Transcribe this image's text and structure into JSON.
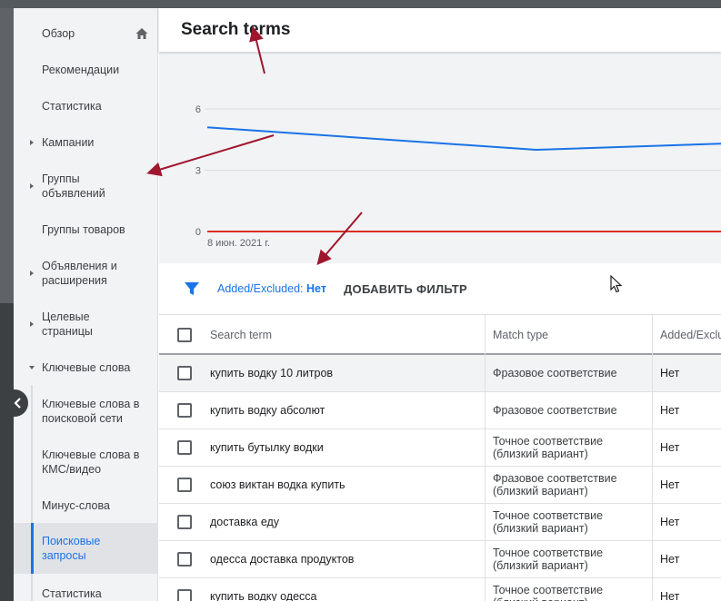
{
  "page_title": "Search terms",
  "sidebar": {
    "items": [
      {
        "label": "Обзор",
        "caret": "none"
      },
      {
        "label": "Рекомендации",
        "caret": "none"
      },
      {
        "label": "Статистика",
        "caret": "none"
      },
      {
        "label": "Кампании",
        "caret": "right"
      },
      {
        "label": "Группы объявлений",
        "caret": "right"
      },
      {
        "label": "Группы товаров",
        "caret": "none"
      },
      {
        "label": "Объявления и расширения",
        "caret": "right"
      },
      {
        "label": "Целевые страницы",
        "caret": "right"
      },
      {
        "label": "Ключевые слова",
        "caret": "down"
      }
    ],
    "subitems": [
      {
        "label": "Ключевые слова в поисковой сети"
      },
      {
        "label": "Ключевые слова в КМС/видео"
      },
      {
        "label": "Минус-слова"
      },
      {
        "label": "Поисковые запросы",
        "selected": true
      },
      {
        "label": "Статистика"
      }
    ]
  },
  "chart_data": {
    "type": "line",
    "x_start_label": "8 июн. 2021 г.",
    "ylim": [
      0,
      6
    ],
    "yticks": [
      "0",
      "3",
      "6"
    ],
    "series": [
      {
        "color": "#1a73e8",
        "points": [
          [
            0,
            5.1
          ],
          [
            0.64,
            4.0
          ],
          [
            1.0,
            4.3
          ]
        ]
      },
      {
        "color": "#d93025",
        "points": [
          [
            0,
            0
          ],
          [
            1.0,
            0
          ]
        ]
      }
    ],
    "grid": true
  },
  "filter": {
    "chip_key": "Added/Excluded:",
    "chip_value": "Нет",
    "add_label": "ДОБАВИТЬ ФИЛЬТР"
  },
  "table": {
    "headers": [
      "Search term",
      "Match type",
      "Added/Exclu"
    ],
    "rows": [
      {
        "term": "купить водку 10 литров",
        "match": "Фразовое соответствие",
        "added": "Нет"
      },
      {
        "term": "купить водку абсолют",
        "match": "Фразовое соответствие",
        "added": "Нет"
      },
      {
        "term": "купить бутылку водки",
        "match": "Точное соответствие (близкий вариант)",
        "added": "Нет"
      },
      {
        "term": "союз виктан водка купить",
        "match": "Фразовое соответствие (близкий вариант)",
        "added": "Нет"
      },
      {
        "term": "доставка еду",
        "match": "Точное соответствие (близкий вариант)",
        "added": "Нет"
      },
      {
        "term": "одесса доставка продуктов",
        "match": "Точное соответствие (близкий вариант)",
        "added": "Нет"
      },
      {
        "term": "купить водку одесса",
        "match": "Точное соответствие (близкий вариант)",
        "added": "Нет"
      }
    ]
  },
  "colors": {
    "accent": "#1a73e8",
    "annotation_arrow": "#a0152e",
    "sidebar_bg": "#f1f3f4"
  },
  "icons": {
    "home": "home-icon",
    "filter": "filter-icon",
    "collapse": "chevron-left-icon",
    "cursor": "mouse-cursor-icon"
  }
}
